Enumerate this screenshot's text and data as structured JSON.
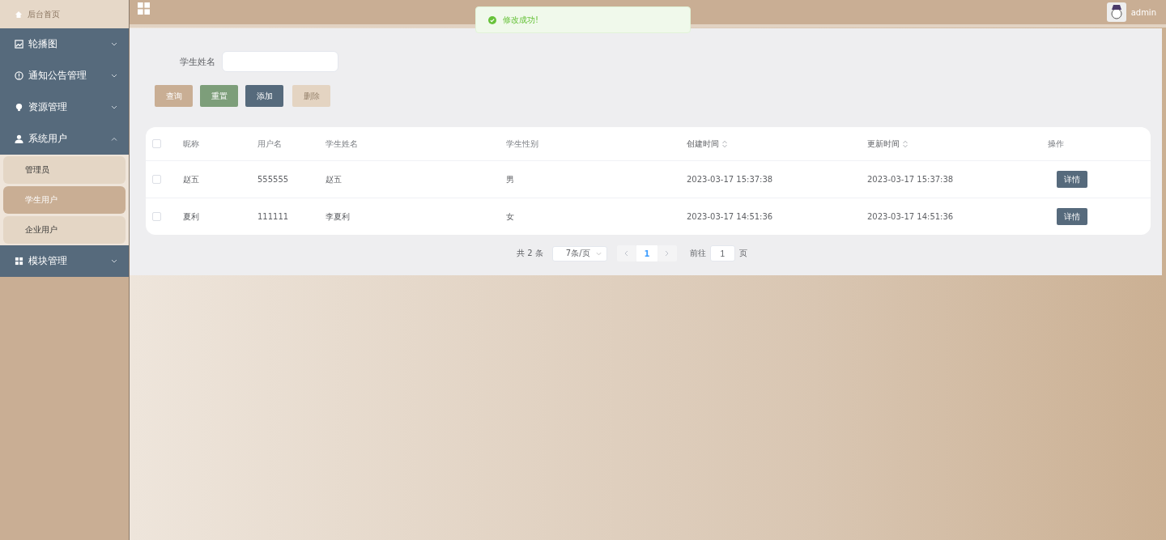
{
  "sidebar": {
    "home": "后台首页",
    "menus": [
      {
        "label": "轮播图",
        "expanded": false
      },
      {
        "label": "通知公告管理",
        "expanded": false
      },
      {
        "label": "资源管理",
        "expanded": false
      },
      {
        "label": "系统用户",
        "expanded": true,
        "children": [
          {
            "label": "管理员",
            "selected": false
          },
          {
            "label": "学生用户",
            "selected": true
          },
          {
            "label": "企业用户",
            "selected": false
          }
        ]
      },
      {
        "label": "模块管理",
        "expanded": false
      }
    ]
  },
  "header": {
    "user": "admin"
  },
  "toast": {
    "message": "修改成功!"
  },
  "search": {
    "label": "学生姓名"
  },
  "buttons": [
    {
      "label": "查询",
      "kind": "query"
    },
    {
      "label": "重置",
      "kind": "reset"
    },
    {
      "label": "添加",
      "kind": "add"
    },
    {
      "label": "删除",
      "kind": "delete"
    }
  ],
  "table": {
    "all_checked": false,
    "columns": [
      {
        "label": "昵称",
        "sortable": false
      },
      {
        "label": "用户名",
        "sortable": false
      },
      {
        "label": "学生姓名",
        "sortable": false
      },
      {
        "label": "学生性别",
        "sortable": false
      },
      {
        "label": "创建时间",
        "sortable": true
      },
      {
        "label": "更新时间",
        "sortable": true
      },
      {
        "label": "操作",
        "sortable": false
      }
    ],
    "rows": [
      {
        "checked": false,
        "cells": [
          "赵五",
          "555555",
          "赵五",
          "男",
          "2023-03-17 15:37:38",
          "2023-03-17 15:37:38"
        ],
        "action": "详情"
      },
      {
        "checked": false,
        "cells": [
          "夏利",
          "111111",
          "李夏利",
          "女",
          "2023-03-17 14:51:36",
          "2023-03-17 14:51:36"
        ],
        "action": "详情"
      }
    ]
  },
  "pagination": {
    "total": "共 2 条",
    "page_size": "7条/页",
    "pages": [
      {
        "label": "1",
        "selected": true
      }
    ],
    "goto_label": "前往",
    "goto_value": "1",
    "goto_suffix": "页"
  }
}
